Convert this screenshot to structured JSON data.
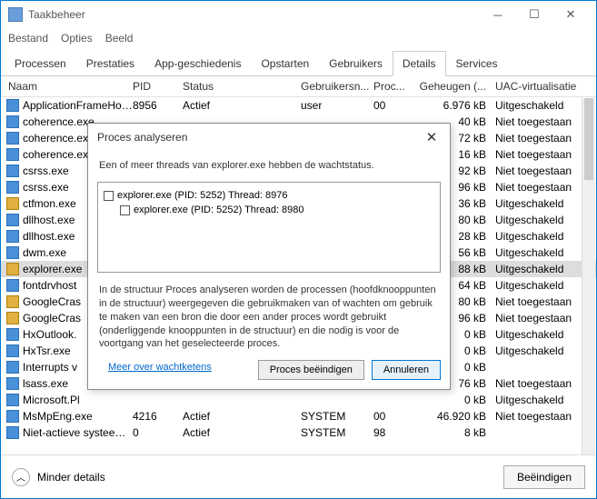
{
  "window": {
    "title": "Taakbeheer"
  },
  "menu": {
    "file": "Bestand",
    "options": "Opties",
    "view": "Beeld"
  },
  "tabs": {
    "processes": "Processen",
    "performance": "Prestaties",
    "apphistory": "App-geschiedenis",
    "startup": "Opstarten",
    "users": "Gebruikers",
    "details": "Details",
    "services": "Services"
  },
  "columns": {
    "name": "Naam",
    "pid": "PID",
    "status": "Status",
    "user": "Gebruikersn...",
    "proc": "Proc...",
    "mem": "Geheugen (...",
    "uac": "UAC-virtualisatie"
  },
  "rows": [
    {
      "name": "ApplicationFrameHos...",
      "pid": "8956",
      "status": "Actief",
      "user": "user",
      "proc": "00",
      "mem": "6.976 kB",
      "uac": "Uitgeschakeld",
      "sel": false,
      "alt": false
    },
    {
      "name": "coherence.exe",
      "pid": "",
      "status": "",
      "user": "",
      "proc": "",
      "mem": "40 kB",
      "uac": "Niet toegestaan",
      "sel": false,
      "alt": false
    },
    {
      "name": "coherence.exe",
      "pid": "",
      "status": "",
      "user": "",
      "proc": "",
      "mem": "72 kB",
      "uac": "Niet toegestaan",
      "sel": false,
      "alt": false
    },
    {
      "name": "coherence.exe",
      "pid": "",
      "status": "",
      "user": "",
      "proc": "",
      "mem": "16 kB",
      "uac": "Niet toegestaan",
      "sel": false,
      "alt": false
    },
    {
      "name": "csrss.exe",
      "pid": "",
      "status": "",
      "user": "",
      "proc": "",
      "mem": "92 kB",
      "uac": "Niet toegestaan",
      "sel": false,
      "alt": false
    },
    {
      "name": "csrss.exe",
      "pid": "",
      "status": "",
      "user": "",
      "proc": "",
      "mem": "96 kB",
      "uac": "Niet toegestaan",
      "sel": false,
      "alt": false
    },
    {
      "name": "ctfmon.exe",
      "pid": "",
      "status": "",
      "user": "",
      "proc": "",
      "mem": "36 kB",
      "uac": "Uitgeschakeld",
      "sel": false,
      "alt": true
    },
    {
      "name": "dllhost.exe",
      "pid": "",
      "status": "",
      "user": "",
      "proc": "",
      "mem": "80 kB",
      "uac": "Uitgeschakeld",
      "sel": false,
      "alt": false
    },
    {
      "name": "dllhost.exe",
      "pid": "",
      "status": "",
      "user": "",
      "proc": "",
      "mem": "28 kB",
      "uac": "Uitgeschakeld",
      "sel": false,
      "alt": false
    },
    {
      "name": "dwm.exe",
      "pid": "",
      "status": "",
      "user": "",
      "proc": "",
      "mem": "56 kB",
      "uac": "Uitgeschakeld",
      "sel": false,
      "alt": false
    },
    {
      "name": "explorer.exe",
      "pid": "",
      "status": "",
      "user": "",
      "proc": "",
      "mem": "88 kB",
      "uac": "Uitgeschakeld",
      "sel": true,
      "alt": true
    },
    {
      "name": "fontdrvhost",
      "pid": "",
      "status": "",
      "user": "",
      "proc": "",
      "mem": "64 kB",
      "uac": "Uitgeschakeld",
      "sel": false,
      "alt": false
    },
    {
      "name": "GoogleCras",
      "pid": "",
      "status": "",
      "user": "",
      "proc": "",
      "mem": "80 kB",
      "uac": "Niet toegestaan",
      "sel": false,
      "alt": true
    },
    {
      "name": "GoogleCras",
      "pid": "",
      "status": "",
      "user": "",
      "proc": "",
      "mem": "96 kB",
      "uac": "Niet toegestaan",
      "sel": false,
      "alt": true
    },
    {
      "name": "HxOutlook.",
      "pid": "",
      "status": "",
      "user": "",
      "proc": "",
      "mem": "0 kB",
      "uac": "Uitgeschakeld",
      "sel": false,
      "alt": false
    },
    {
      "name": "HxTsr.exe",
      "pid": "",
      "status": "",
      "user": "",
      "proc": "",
      "mem": "0 kB",
      "uac": "Uitgeschakeld",
      "sel": false,
      "alt": false
    },
    {
      "name": "Interrupts v",
      "pid": "",
      "status": "",
      "user": "",
      "proc": "",
      "mem": "0 kB",
      "uac": "",
      "sel": false,
      "alt": false
    },
    {
      "name": "lsass.exe",
      "pid": "",
      "status": "",
      "user": "",
      "proc": "",
      "mem": "76 kB",
      "uac": "Niet toegestaan",
      "sel": false,
      "alt": false
    },
    {
      "name": "Microsoft.Pl",
      "pid": "",
      "status": "",
      "user": "",
      "proc": "",
      "mem": "0 kB",
      "uac": "Uitgeschakeld",
      "sel": false,
      "alt": false
    },
    {
      "name": "MsMpEng.exe",
      "pid": "4216",
      "status": "Actief",
      "user": "SYSTEM",
      "proc": "00",
      "mem": "46.920 kB",
      "uac": "Niet toegestaan",
      "sel": false,
      "alt": false
    },
    {
      "name": "Niet-actieve systeem...",
      "pid": "0",
      "status": "Actief",
      "user": "SYSTEM",
      "proc": "98",
      "mem": "8 kB",
      "uac": "",
      "sel": false,
      "alt": false
    }
  ],
  "dialog": {
    "title": "Proces analyseren",
    "message": "Een of meer threads van explorer.exe hebben de wachtstatus.",
    "tree0": "explorer.exe (PID: 5252) Thread: 8976",
    "tree1": "explorer.exe (PID: 5252) Thread: 8980",
    "desc": "In de structuur Proces analyseren worden de processen (hoofdknooppunten in de structuur) weergegeven die gebruikmaken van of wachten om gebruik te maken van een bron die door een ander proces wordt gebruikt (onderliggende knooppunten in de structuur) en die nodig is voor de voortgang van het geselecteerde proces.",
    "link": "Meer over wachtketens",
    "end": "Proces beëindigen",
    "cancel": "Annuleren"
  },
  "footer": {
    "fewer": "Minder details",
    "end": "Beëindigen"
  }
}
